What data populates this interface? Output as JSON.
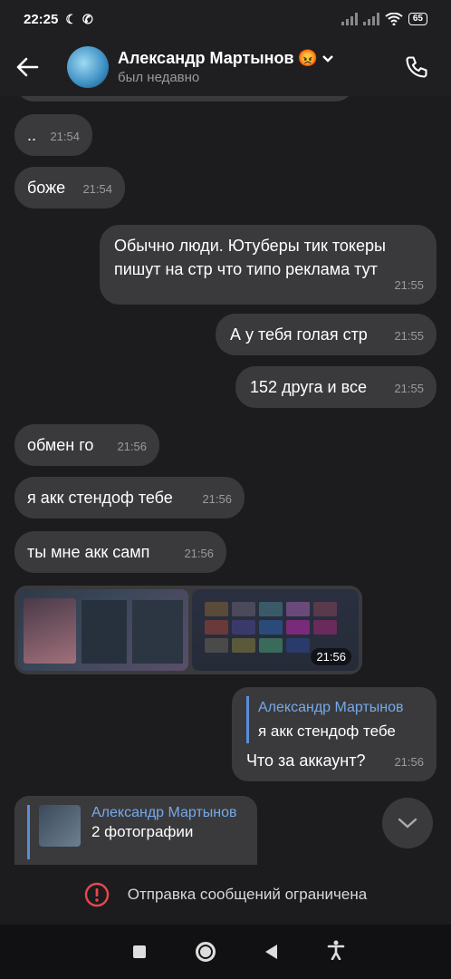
{
  "status_bar": {
    "time": "22:25",
    "battery": "65"
  },
  "header": {
    "name": "Александр Мартынов",
    "status": "был недавно"
  },
  "messages": [
    {
      "text": "..",
      "time": "21:54"
    },
    {
      "text": "боже",
      "time": "21:54"
    },
    {
      "line1": "Обычно люди. Ютуберы тик токеры",
      "line2": "пишут на стр что типо реклама тут",
      "time": "21:55"
    },
    {
      "text": "А у тебя голая стр",
      "time": "21:55"
    },
    {
      "text": "152 друга и все",
      "time": "21:55"
    },
    {
      "text": "обмен го",
      "time": "21:56"
    },
    {
      "text": "я акк стендоф тебе",
      "time": "21:56"
    },
    {
      "text": "ты мне акк самп",
      "time": "21:56"
    },
    {
      "time": "21:56"
    },
    {
      "reply_name": "Александр Мартынов",
      "reply_text": "я акк стендоф тебе",
      "text": "Что за аккаунт?",
      "time": "21:56"
    }
  ],
  "pinned": {
    "name": "Александр Мартынов",
    "text": "2 фотографии"
  },
  "restriction": {
    "text": "Отправка сообщений ограничена"
  }
}
